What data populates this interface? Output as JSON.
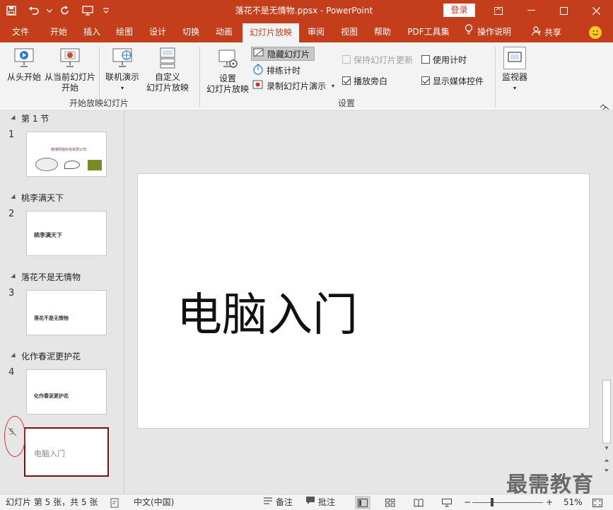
{
  "window": {
    "title": "落花不是无情物.ppsx  -  PowerPoint",
    "login_label": "登录"
  },
  "tabs": [
    {
      "label": "文件"
    },
    {
      "label": "开始"
    },
    {
      "label": "插入"
    },
    {
      "label": "绘图"
    },
    {
      "label": "设计"
    },
    {
      "label": "切换"
    },
    {
      "label": "动画"
    },
    {
      "label": "幻灯片放映"
    },
    {
      "label": "审阅"
    },
    {
      "label": "视图"
    },
    {
      "label": "帮助"
    },
    {
      "label": "PDF工具集"
    }
  ],
  "tell_me": "操作说明",
  "share": "共享",
  "ribbon": {
    "start_group": {
      "from_beginning": "从头开始",
      "from_current_1": "从当前幻灯片",
      "from_current_2": "开始",
      "online": "联机演示",
      "custom_1": "自定义",
      "custom_2": "幻灯片放映",
      "label": "开始放映幻灯片"
    },
    "setup_group": {
      "setup_1": "设置",
      "setup_2": "幻灯片放映",
      "hide_slide": "隐藏幻灯片",
      "rehearse": "排练计时",
      "record": "录制幻灯片演示",
      "keep_updated": "保持幻灯片更新",
      "use_timings": "使用计时",
      "play_narrations": "播放旁白",
      "show_media_controls": "显示媒体控件",
      "label": "设置"
    },
    "monitor_group": {
      "monitor": "监视器"
    }
  },
  "sections": [
    {
      "name": "第 1 节"
    },
    {
      "name": "桃李满天下"
    },
    {
      "name": "落花不是无情物"
    },
    {
      "name": "化作春泥更护花"
    }
  ],
  "slides": [
    {
      "number": "1",
      "thumb_text": "微博网络科技有限公司"
    },
    {
      "number": "2",
      "thumb_text": "桃李满天下"
    },
    {
      "number": "3",
      "thumb_text": "落花不是无情物"
    },
    {
      "number": "4",
      "thumb_text": "化作春泥更护花"
    },
    {
      "number": "5",
      "thumb_text": "电脑入门",
      "hidden": true
    }
  ],
  "current_slide": {
    "title": "电脑入门"
  },
  "watermark": "最需教育",
  "status": {
    "slide_info": "幻灯片 第 5 张，共 5 张",
    "language": "中文(中国)",
    "notes": "备注",
    "comments": "批注",
    "zoom": "51%"
  },
  "colors": {
    "accent": "#c43e1c",
    "selected_border": "#7a1010",
    "annotation": "#e03030"
  }
}
